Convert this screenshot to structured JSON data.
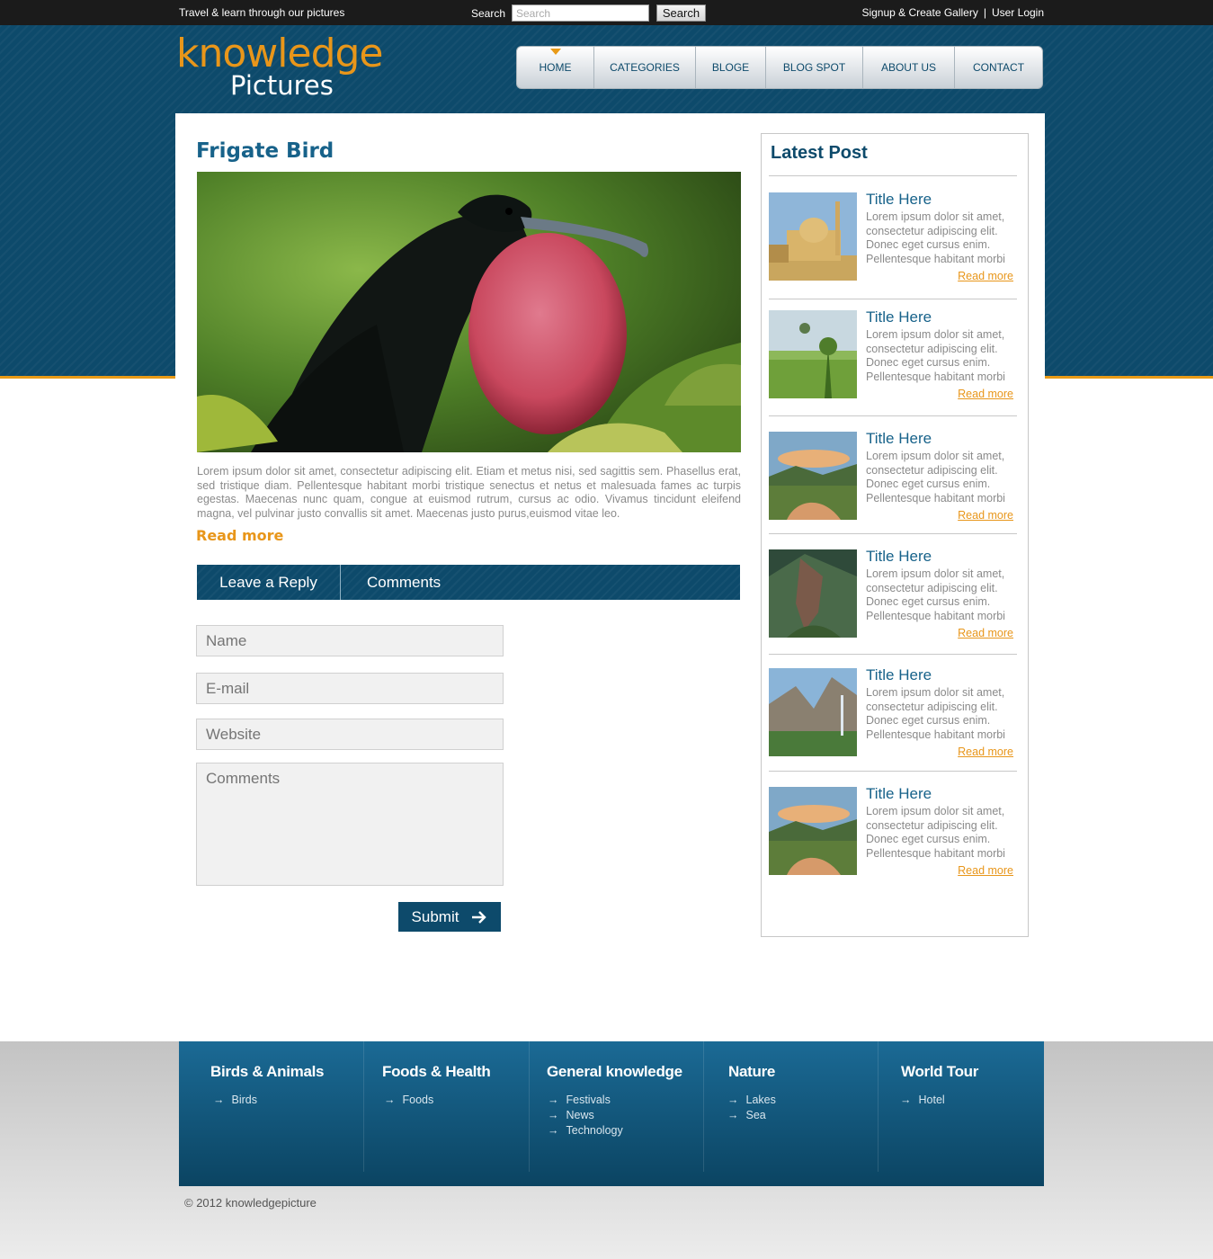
{
  "topbar": {
    "tagline": "Travel & learn through our pictures",
    "search_label": "Search",
    "search_placeholder": "Search",
    "search_button": "Search",
    "signup": "Signup & Create Gallery",
    "separator": "|",
    "login": "User Login"
  },
  "logo": {
    "top": "knowledge",
    "bottom": "Pictures"
  },
  "nav": {
    "items": [
      {
        "label": "HOME"
      },
      {
        "label": "CATEGORIES"
      },
      {
        "label": "BLOGE"
      },
      {
        "label": "BLOG SPOT"
      },
      {
        "label": "ABOUT US"
      },
      {
        "label": "CONTACT"
      }
    ],
    "active": "HOME"
  },
  "post": {
    "title": "Frigate Bird",
    "body": "Lorem ipsum dolor sit amet, consectetur adipiscing elit. Etiam et metus nisi, sed sagittis sem. Phasellus erat, sed tristique diam. Pellentesque habitant morbi tristique senectus et netus et malesuada fames ac turpis egestas. Maecenas nunc quam, congue at euismod rutrum, cursus ac odio. Vivamus tincidunt eleifend magna, vel pulvinar justo convallis sit amet. Maecenas justo purus,euismod vitae leo.",
    "read_more": "Read more"
  },
  "reply": {
    "tab_reply": "Leave a Reply",
    "tab_comments": "Comments",
    "name_placeholder": "Name",
    "email_placeholder": "E-mail",
    "website_placeholder": "Website",
    "comments_placeholder": "Comments",
    "submit": "Submit"
  },
  "sidebar": {
    "title": "Latest Post",
    "posts": [
      {
        "title": "Title Here",
        "text": "Lorem ipsum dolor sit amet, consectetur adipiscing elit. Donec eget cursus enim. Pellentesque habitant morbi",
        "more": "Read more"
      },
      {
        "title": "Title Here",
        "text": "Lorem ipsum dolor sit amet, consectetur adipiscing elit. Donec eget cursus enim. Pellentesque habitant morbi",
        "more": "Read more"
      },
      {
        "title": "Title Here",
        "text": "Lorem ipsum dolor sit amet, consectetur adipiscing elit. Donec eget cursus enim. Pellentesque habitant morbi",
        "more": "Read more"
      },
      {
        "title": "Title Here",
        "text": "Lorem ipsum dolor sit amet, consectetur adipiscing elit. Donec eget cursus enim. Pellentesque habitant morbi",
        "more": "Read more"
      },
      {
        "title": "Title Here",
        "text": "Lorem ipsum dolor sit amet, consectetur adipiscing elit. Donec eget cursus enim. Pellentesque habitant morbi",
        "more": "Read more"
      },
      {
        "title": "Title Here",
        "text": "Lorem ipsum dolor sit amet, consectetur adipiscing elit. Donec eget cursus enim. Pellentesque habitant morbi",
        "more": "Read more"
      }
    ]
  },
  "footer": {
    "columns": [
      {
        "title": "Birds & Animals",
        "links": [
          "Birds"
        ]
      },
      {
        "title": "Foods & Health",
        "links": [
          "Foods"
        ]
      },
      {
        "title": "General knowledge",
        "links": [
          "Festivals",
          "News",
          "Technology"
        ]
      },
      {
        "title": "Nature",
        "links": [
          "Lakes",
          "Sea"
        ]
      },
      {
        "title": "World Tour",
        "links": [
          "Hotel"
        ]
      }
    ],
    "copyright": "© 2012 knowledgepicture"
  },
  "colors": {
    "brand_blue": "#0d4a6b",
    "accent_orange": "#e8961a",
    "title_blue": "#17628a"
  }
}
